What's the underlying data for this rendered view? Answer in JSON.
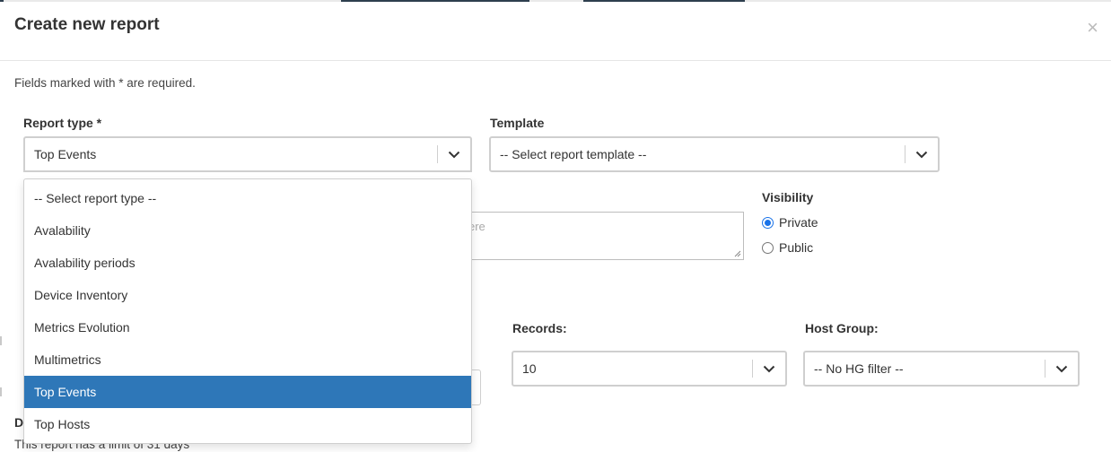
{
  "modal": {
    "title": "Create new report",
    "close_glyph": "×",
    "required_note": "Fields marked with * are required."
  },
  "report_type": {
    "label": "Report type *",
    "selected": "Top Events",
    "options": [
      "-- Select report type --",
      "Avalability",
      "Avalability periods",
      "Device Inventory",
      "Metrics Evolution",
      "Multimetrics",
      "Top Events",
      "Top Hosts"
    ],
    "selected_index": 6
  },
  "template": {
    "label": "Template",
    "selected": "-- Select report template --"
  },
  "description": {
    "placeholder_fragment": "ere"
  },
  "visibility": {
    "label": "Visibility",
    "options": [
      {
        "label": "Private",
        "checked": true
      },
      {
        "label": "Public",
        "checked": false
      }
    ]
  },
  "records": {
    "label": "Records:",
    "selected": "10"
  },
  "host_group": {
    "label": "Host Group:",
    "selected": "-- No HG filter --"
  },
  "date_section": {
    "label_fragment": "D",
    "limit_note": "This report has a limit of 31 days"
  },
  "icons": {
    "chevron": "chevron-down-icon",
    "close": "close-icon",
    "resize": "resize-grip-icon"
  },
  "colors": {
    "selected_option_bg": "#2e77b8",
    "radio_accent": "#1a73e8",
    "border": "#cfcfcf"
  }
}
